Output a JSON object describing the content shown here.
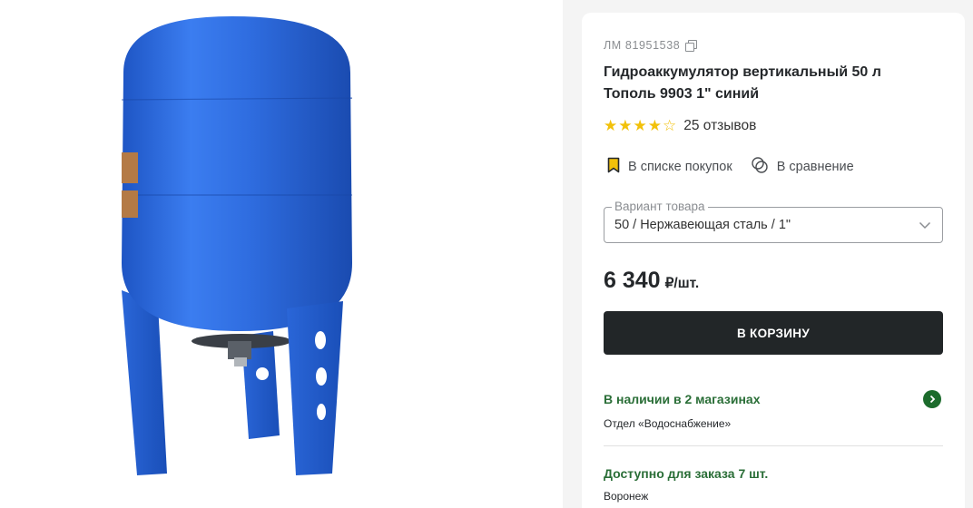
{
  "product": {
    "sku": "ЛМ 81951538",
    "title": "Гидроаккумулятор вертикальный 50 л Тополь 9903 1\" синий",
    "rating": 4,
    "rating_max": 5,
    "reviews": "25 отзывов",
    "image_alt": "blue-vertical-tank"
  },
  "actions": {
    "shopping_list": "В списке покупок",
    "compare": "В сравнение"
  },
  "variant": {
    "label": "Вариант товара",
    "value": "50 / Нержавеющая сталь / 1\""
  },
  "price": {
    "amount": "6 340",
    "unit": "₽/шт."
  },
  "cart": {
    "button_label": "В КОРЗИНУ"
  },
  "availability": {
    "stock_title": "В наличии в 2 магазинах",
    "stock_department": "Отдел «Водоснабжение»",
    "order_title": "Доступно для заказа 7 шт.",
    "order_city": "Воронеж"
  },
  "colors": {
    "accent_green": "#1c6b2c",
    "star": "#f2c10a",
    "button_dark": "#222628",
    "tank_blue": "#2d6bd6"
  },
  "icons": [
    "copy-icon",
    "bookmark-icon",
    "compare-icon",
    "chevron-down-icon",
    "chevron-right-icon"
  ]
}
